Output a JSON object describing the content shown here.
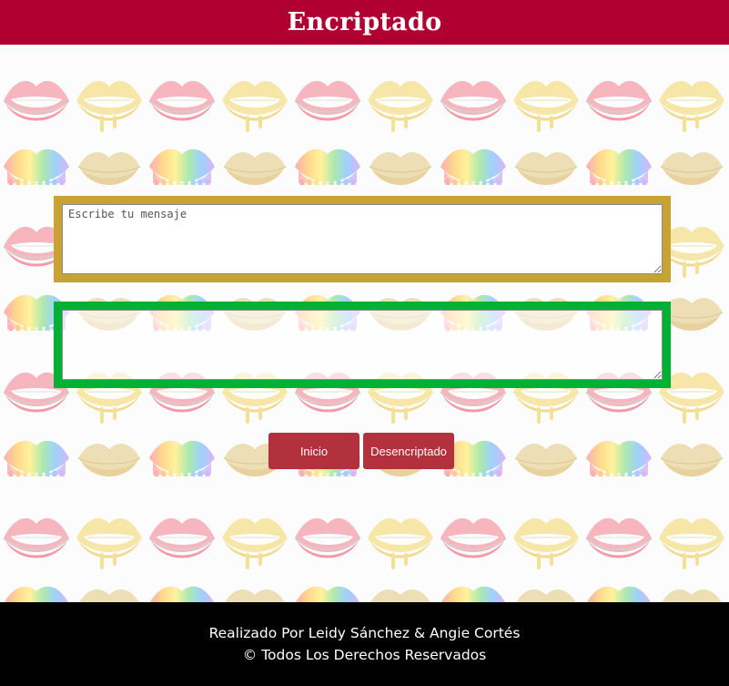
{
  "header": {
    "title": "Encriptado"
  },
  "input_panel": {
    "placeholder": "Escribe tu mensaje",
    "value": ""
  },
  "output_panel": {
    "placeholder": "",
    "value": ""
  },
  "buttons": {
    "start_label": "Inicio",
    "decrypt_label": "Desencriptado"
  },
  "footer": {
    "credits": "Realizado Por Leidy Sánchez & Angie Cortés",
    "rights": "© Todos Los Derechos Reservados"
  },
  "colors": {
    "header_bg": "#b00032",
    "input_border": "#c9a234",
    "output_border": "#00b134",
    "button_bg": "#b3303d",
    "footer_bg": "#000000"
  },
  "icons": {
    "background_pattern": "lips-pattern"
  }
}
